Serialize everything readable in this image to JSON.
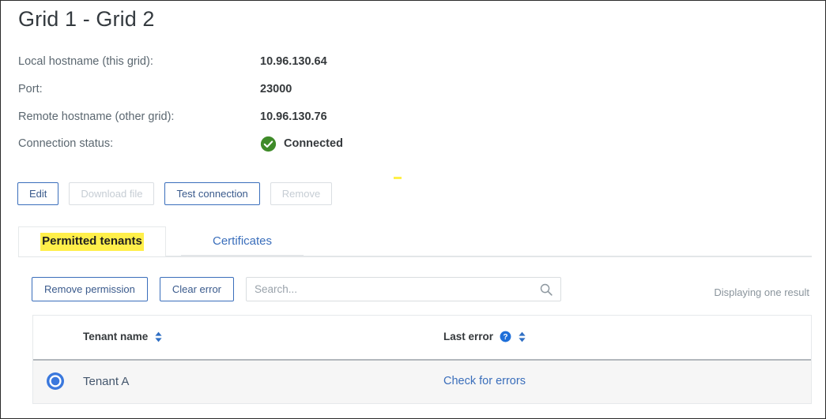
{
  "page": {
    "title": "Grid 1 - Grid 2"
  },
  "details": {
    "rows": [
      {
        "label": "Local hostname (this grid):",
        "value": "10.96.130.64"
      },
      {
        "label": "Port:",
        "value": "23000"
      },
      {
        "label": "Remote hostname (other grid):",
        "value": "10.96.130.76"
      }
    ],
    "status": {
      "label": "Connection status:",
      "value": "Connected",
      "icon": "check-circle-icon",
      "color": "#3f8b29"
    }
  },
  "actions": {
    "buttons": [
      {
        "label": "Edit",
        "enabled": true
      },
      {
        "label": "Download file",
        "enabled": false
      },
      {
        "label": "Test connection",
        "enabled": true
      },
      {
        "label": "Remove",
        "enabled": false
      }
    ]
  },
  "tabs": {
    "items": [
      {
        "label": "Permitted tenants",
        "active": true
      },
      {
        "label": "Certificates",
        "active": false
      }
    ],
    "highlight_color": "#ffef4a"
  },
  "toolbar": {
    "remove_permission_label": "Remove permission",
    "clear_error_label": "Clear error",
    "search_placeholder": "Search...",
    "search_value": "",
    "search_icon": "magnifier-icon",
    "result_count": "Displaying one result"
  },
  "table": {
    "columns": [
      {
        "label": "Tenant name",
        "sortable": true,
        "help": false
      },
      {
        "label": "Last error",
        "sortable": true,
        "help": true
      }
    ],
    "rows": [
      {
        "selected": true,
        "tenant_name": "Tenant A",
        "last_error": "Check for errors"
      }
    ]
  },
  "colors": {
    "accent_blue": "#3a6ebb",
    "link_blue": "#3a6ebb",
    "status_green": "#3f8b29",
    "row_background": "#f6f6f6"
  }
}
